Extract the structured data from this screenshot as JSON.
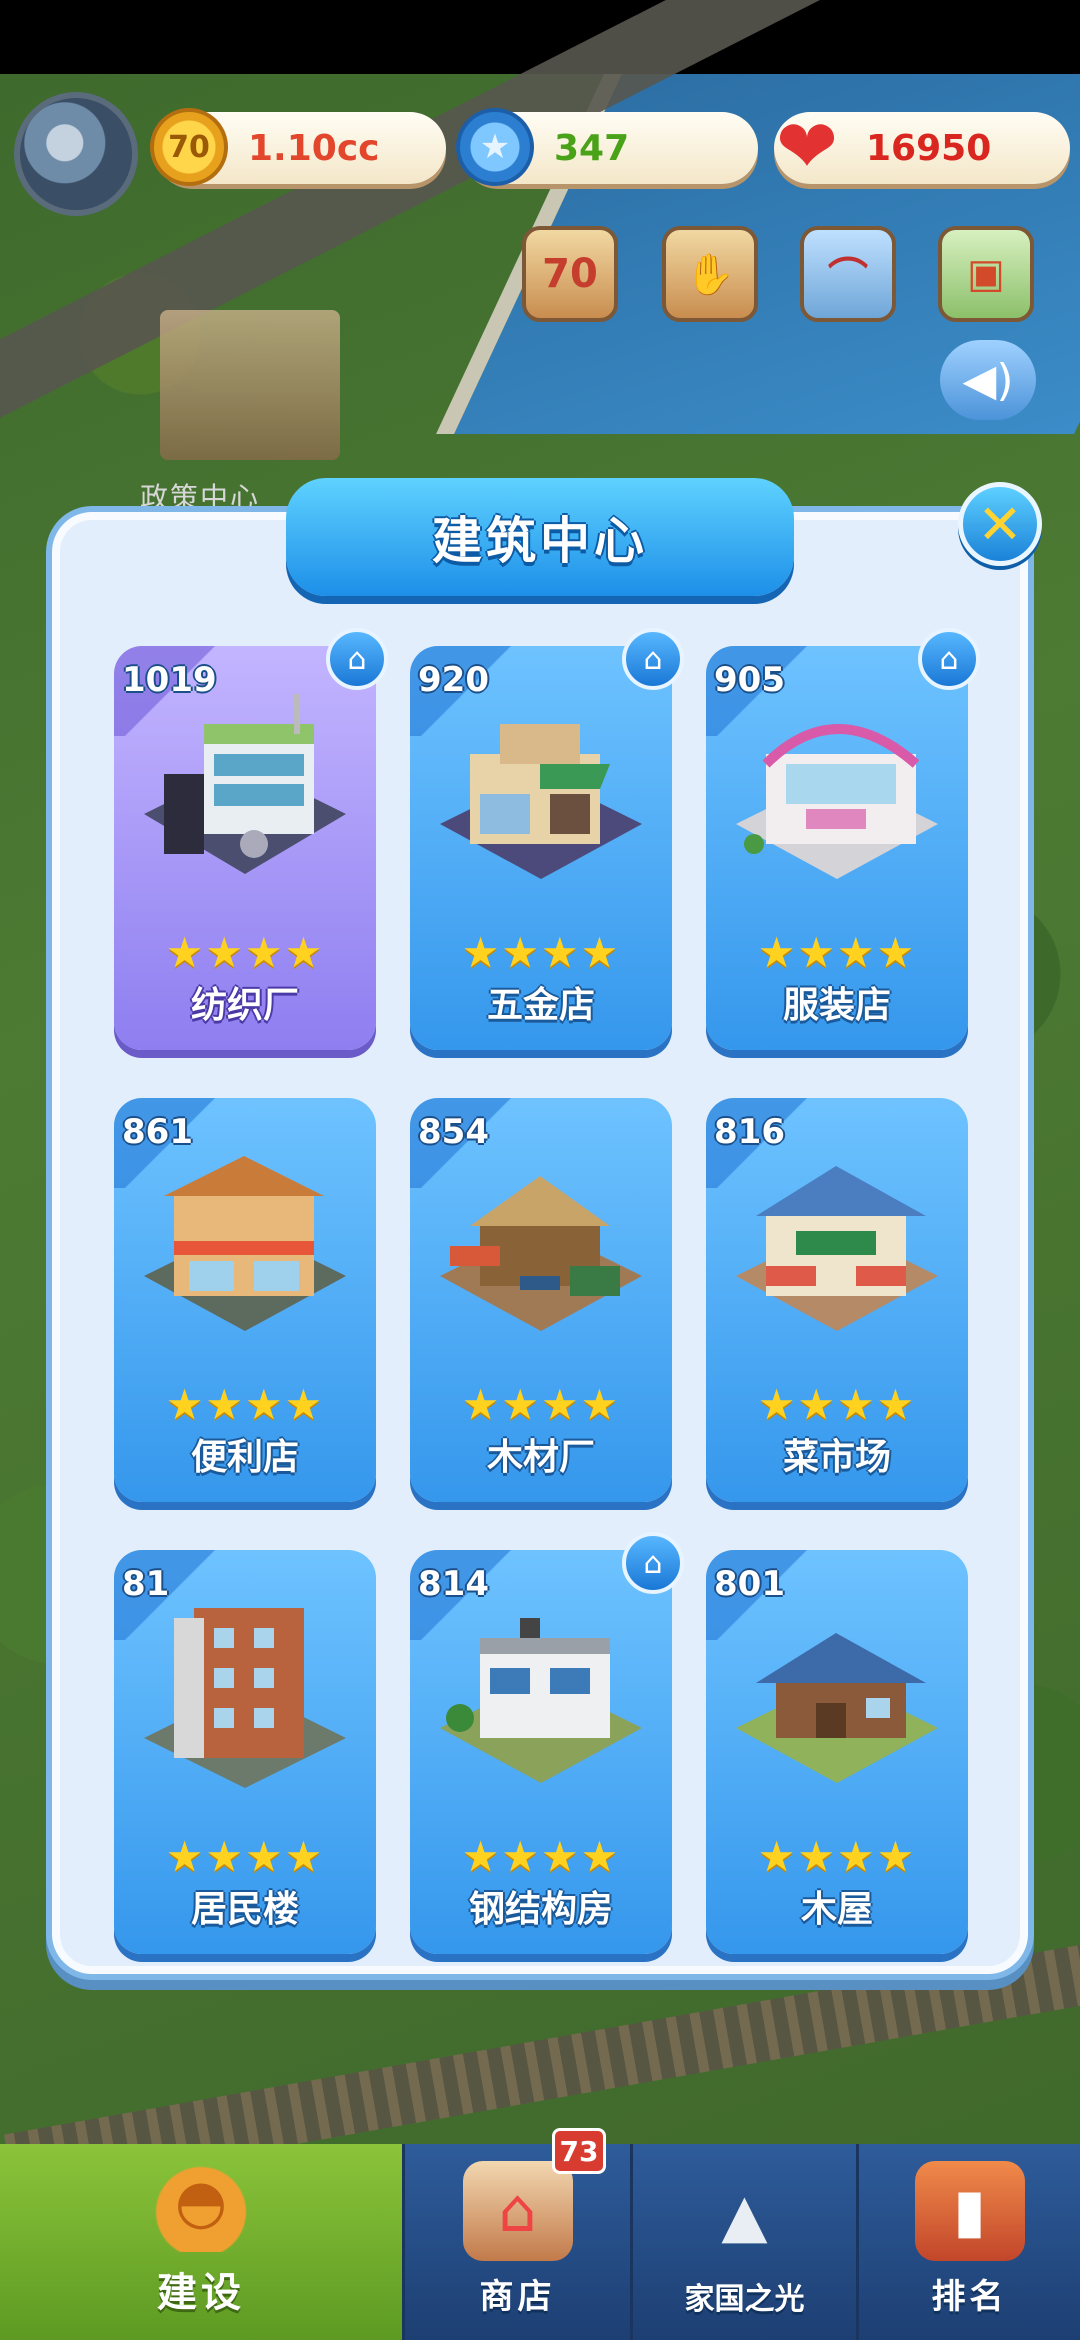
{
  "hud": {
    "coin_value": "1.10cc",
    "coin_icon_text": "70",
    "star_value": "347",
    "heart_value": "16950",
    "icons": [
      "anniversary-70-icon",
      "handshake-icon",
      "bridge-icon",
      "delivery-truck-icon",
      "speaker-icon"
    ],
    "colors": {
      "coin_text": "#e2462c",
      "star_text": "#4aa218",
      "heart_text": "#d9261f"
    }
  },
  "background": {
    "policy_center_label": "政策中心"
  },
  "panel": {
    "title": "建筑中心",
    "close_icon": "✕"
  },
  "cards": [
    {
      "score": "1019",
      "name": "纺织厂",
      "stars": "★★★★",
      "home_badge": true,
      "highlight": true
    },
    {
      "score": "920",
      "name": "五金店",
      "stars": "★★★★",
      "home_badge": true
    },
    {
      "score": "905",
      "name": "服装店",
      "stars": "★★★★",
      "home_badge": true
    },
    {
      "score": "861",
      "name": "便利店",
      "stars": "★★★★",
      "home_badge": false
    },
    {
      "score": "854",
      "name": "木材厂",
      "stars": "★★★★",
      "home_badge": false
    },
    {
      "score": "816",
      "name": "菜市场",
      "stars": "★★★★",
      "home_badge": false
    },
    {
      "score": "81",
      "name": "居民楼",
      "stars": "★★★★",
      "home_badge": false
    },
    {
      "score": "814",
      "name": "钢结构房",
      "stars": "★★★★",
      "home_badge": true
    },
    {
      "score": "801",
      "name": "木屋",
      "stars": "★★★★",
      "home_badge": false
    }
  ],
  "bottom_nav": {
    "items": [
      {
        "label": "建设",
        "icon": "hard-hat-icon",
        "active": true
      },
      {
        "label": "商店",
        "icon": "shop-icon",
        "badge": "73"
      },
      {
        "label": "家国之光",
        "icon": "rocket-icon"
      },
      {
        "label": "排名",
        "icon": "ranking-tower-icon"
      }
    ]
  }
}
